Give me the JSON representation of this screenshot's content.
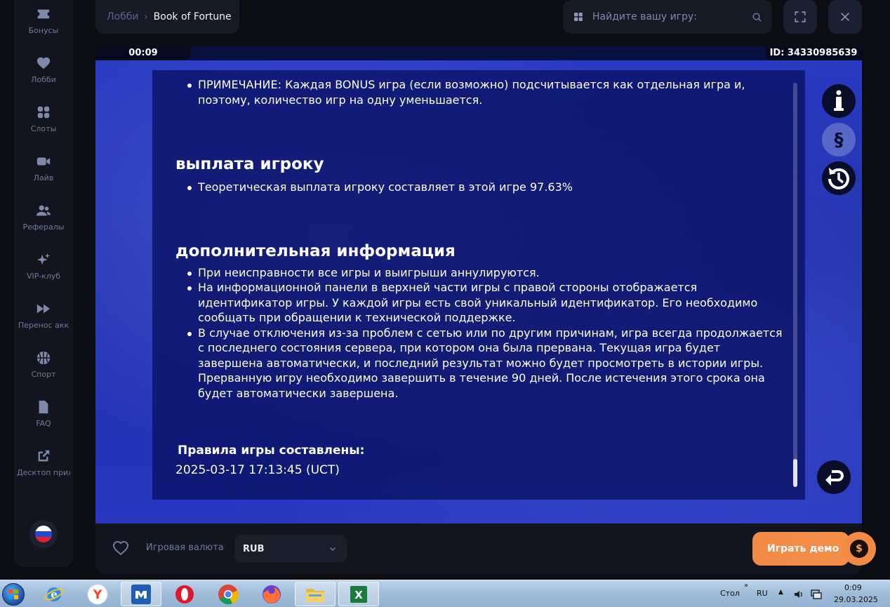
{
  "sidebar": {
    "items": [
      {
        "label": "Бонусы",
        "icon": "ticket-icon"
      },
      {
        "label": "Лобби",
        "icon": "heart-icon"
      },
      {
        "label": "Слоты",
        "icon": "grid-icon"
      },
      {
        "label": "Лайв",
        "icon": "video-camera-icon"
      },
      {
        "label": "Рефералы",
        "icon": "users-icon"
      },
      {
        "label": "VIP-клуб",
        "icon": "sparkles-icon"
      },
      {
        "label": "Перенос акк",
        "icon": "fast-forward-icon"
      },
      {
        "label": "Спорт",
        "icon": "basketball-icon"
      },
      {
        "label": "FAQ",
        "icon": "document-icon"
      },
      {
        "label": "Десктоп прил",
        "icon": "external-link-icon"
      }
    ],
    "language_flag": "russian-flag-icon"
  },
  "header": {
    "breadcrumb": {
      "lobby": "Лобби",
      "current": "Book of Fortune"
    },
    "search": {
      "placeholder": "Найдите вашу игру:"
    }
  },
  "game": {
    "timer": "00:09",
    "game_id": "ID: 34330985639",
    "rules": {
      "note": "ПРИМЕЧАНИЕ: Каждая BONUS игра (если возможно) подсчитывается как отдельная игра и, поэтому, количество игр на одну уменьшается.",
      "payout_heading": "выплата игроку",
      "payout_text": "Теоретическая выплата игроку составляет в этой игре 97.63%",
      "info_heading": "дополнительная информация",
      "info_items": [
        "При неисправности все игры и выигрыши аннулируются.",
        "На информационной панели в верхней части игры с правой стороны отображается идентификатор игры. У каждой игры есть свой уникальный идентификатор. Его необходимо сообщать при обращении к технической поддержке.",
        "В случае отключения из-за проблем с сетью или по другим причинам, игра всегда продолжается с последнего состояния сервера, при котором она была прервана. Текущая игра будет завершена автоматически, и последний результат можно будет просмотреть в истории игры. Прерванную игру необходимо завершить в течение 90 дней. После истечения этого срока она будет автоматически завершена."
      ],
      "composed_label": "Правила игры составлены:",
      "composed_date": "2025-03-17 17:13:45 (UCT)"
    },
    "side_buttons": [
      "info-icon",
      "paragraph-icon",
      "history-icon"
    ],
    "back_button": "back-arrow-icon"
  },
  "footer": {
    "currency_label": "Игровая валюта",
    "currency_value": "RUB",
    "demo_button": "Играть демо"
  },
  "taskbar": {
    "desktop_label": "Стол",
    "language": "RU",
    "time": "0:09",
    "date": "29.03.2025",
    "apps": [
      "internet-explorer-icon",
      "yandex-browser-icon",
      "app-icon",
      "opera-icon",
      "chrome-icon",
      "firefox-icon",
      "file-explorer-icon",
      "excel-icon"
    ]
  },
  "colors": {
    "accent_orange": "#f08a45",
    "game_blue": "#2a3bc4",
    "panel_navy": "#0a1164",
    "background": "#0b0d12"
  }
}
